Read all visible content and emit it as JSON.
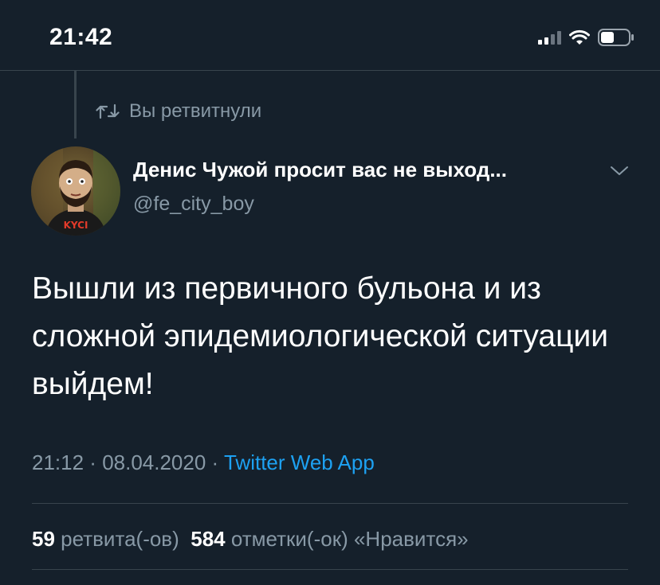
{
  "status_bar": {
    "time": "21:42",
    "icons": [
      "signal-icon",
      "wifi-icon",
      "battery-icon"
    ]
  },
  "retweet_banner": {
    "icon": "retweet-icon",
    "text": "Вы ретвитнули"
  },
  "author": {
    "display_name": "Денис Чужой просит вас не выход...",
    "handle": "@fe_city_boy",
    "avatar_shirt_text": "KYCI"
  },
  "tweet": {
    "text": "Вышли из первичного бульона и из сложной эпидемиологической ситуации выйдем!"
  },
  "meta": {
    "time": "21:12",
    "sep1": " · ",
    "date": "08.04.2020",
    "sep2": " · ",
    "source": "Twitter Web App"
  },
  "stats": {
    "retweets_count": "59",
    "retweets_label": "ретвита(-ов)",
    "likes_count": "584",
    "likes_label": "отметки(-ок) «Нравится»"
  },
  "colors": {
    "background": "#15202b",
    "secondary_text": "#8899a6",
    "link": "#1da1f2",
    "divider": "#38444d"
  }
}
